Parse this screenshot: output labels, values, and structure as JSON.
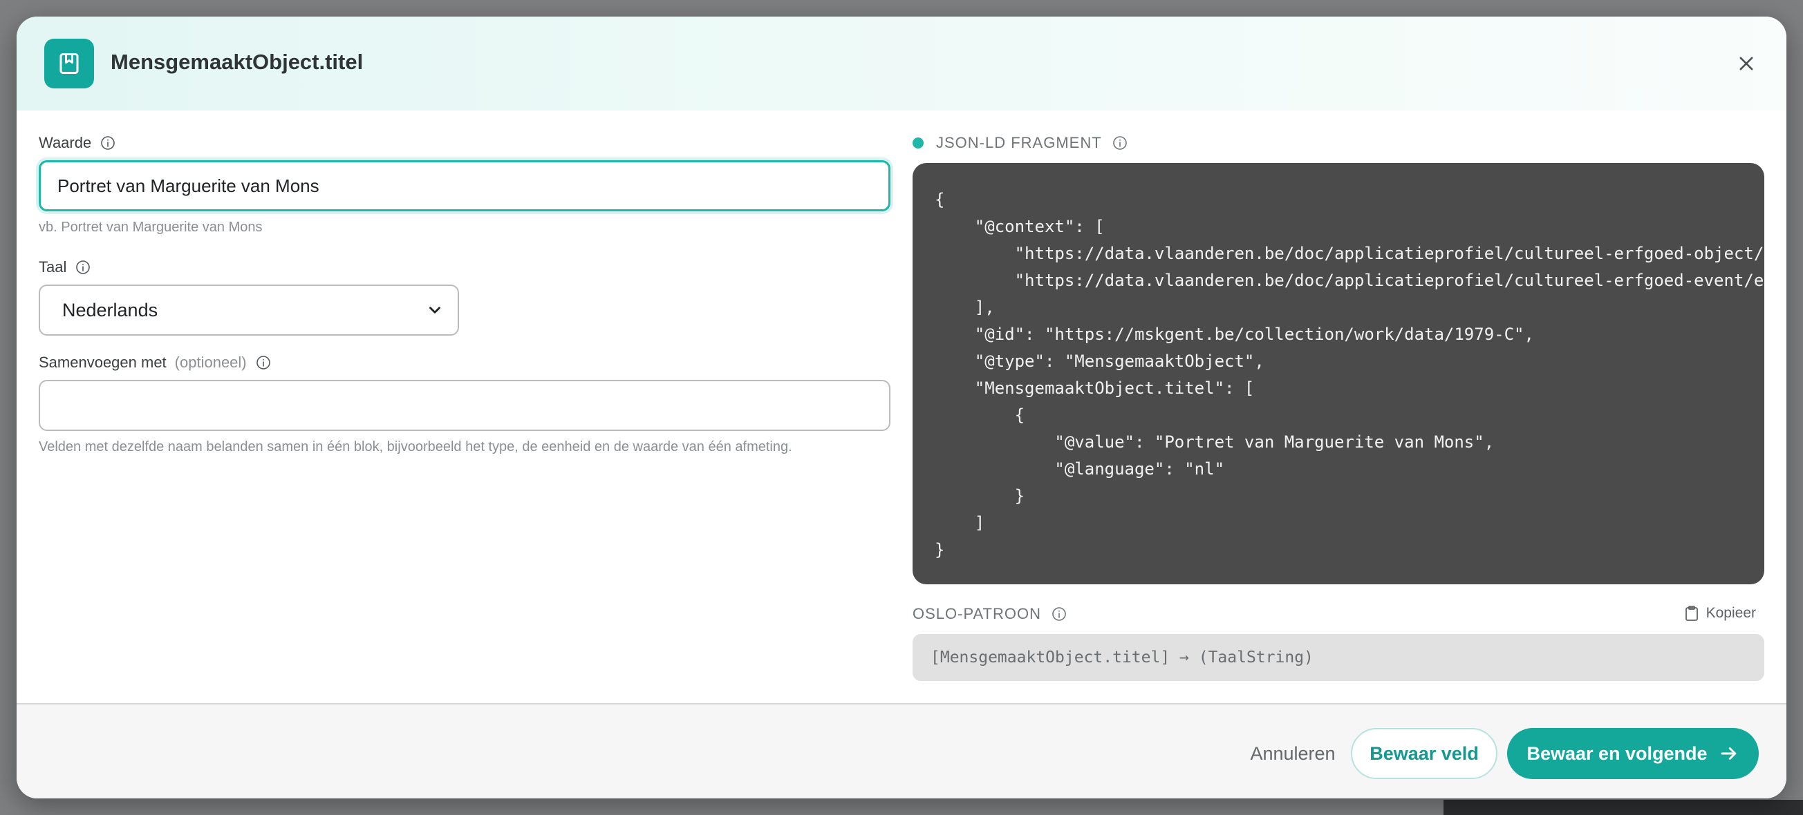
{
  "modal": {
    "title": "MensgemaaktObject.titel",
    "close_icon": "close-icon",
    "header_icon": "book-icon"
  },
  "form": {
    "value": {
      "label": "Waarde",
      "input_value": "Portret van Marguerite van Mons",
      "hint": "vb. Portret van Marguerite van Mons"
    },
    "language": {
      "label": "Taal",
      "selected": "Nederlands"
    },
    "merge": {
      "label": "Samenvoegen met",
      "optional": "(optioneel)",
      "input_value": "",
      "hint": "Velden met dezelfde naam belanden samen in één blok, bijvoorbeeld het type, de eenheid en de waarde van één afmeting."
    }
  },
  "json_ld": {
    "label": "JSON-LD FRAGMENT",
    "code": "{\n    \"@context\": [\n        \"https://data.vlaanderen.be/doc/applicatieprofiel/cultureel-erfgoed-object/\n        \"https://data.vlaanderen.be/doc/applicatieprofiel/cultureel-erfgoed-event/e\n    ],\n    \"@id\": \"https://mskgent.be/collection/work/data/1979-C\",\n    \"@type\": \"MensgemaaktObject\",\n    \"MensgemaaktObject.titel\": [\n        {\n            \"@value\": \"Portret van Marguerite van Mons\",\n            \"@language\": \"nl\"\n        }\n    ]\n}"
  },
  "oslo": {
    "label": "OSLO-PATROON",
    "copy_label": "Kopieer",
    "pattern": "[MensgemaaktObject.titel] → (TaalString)"
  },
  "footer": {
    "cancel_label": "Annuleren",
    "save_label": "Bewaar veld",
    "save_next_label": "Bewaar en volgende"
  },
  "colors": {
    "accent": "#14a89a",
    "code_bg": "#4b4b4b"
  }
}
